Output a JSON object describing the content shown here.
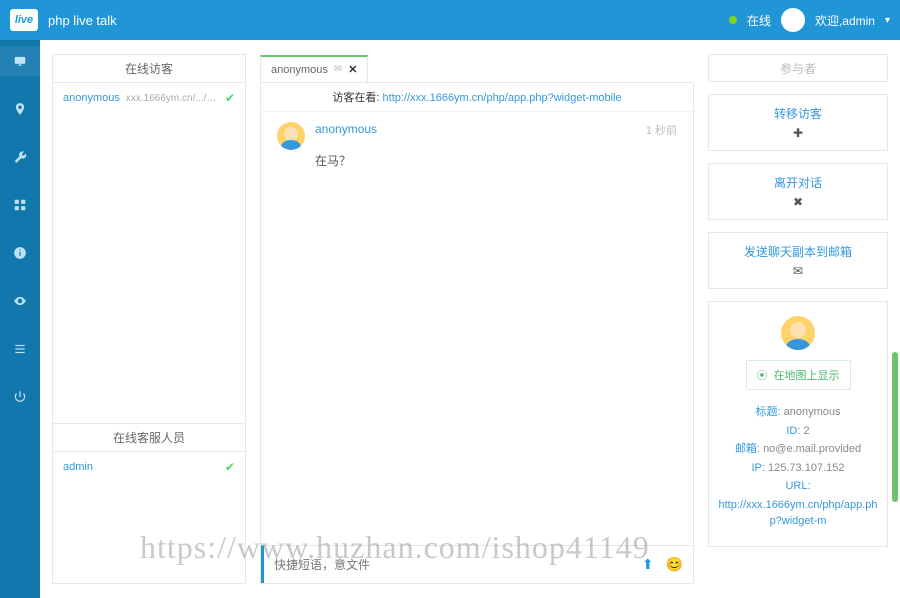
{
  "topbar": {
    "logo_text": "live",
    "title": "php live talk",
    "status": "在线",
    "welcome_prefix": "欢迎,",
    "user": "admin"
  },
  "left_panel": {
    "visitors_header": "在线访客",
    "visitor": {
      "name": "anonymous",
      "url": "xxx.1666ym.cn/.../app...",
      "status": "ok"
    },
    "agents_header": "在线客服人员",
    "agent": {
      "name": "admin",
      "status": "ok"
    }
  },
  "chat_tab": {
    "label": "anonymous"
  },
  "chat_header": {
    "label": "访客在看:",
    "link": "http://xxx.1666ym.cn/php/app.php?widget-mobile"
  },
  "message": {
    "name": "anonymous",
    "time": "1 秒前",
    "text": "在马？"
  },
  "input": {
    "placeholder": "快捷短语，意文件"
  },
  "right": {
    "participants": "参与者",
    "transfer": "转移访客",
    "leave": "离开对话",
    "send_transcript": "发送聊天副本到邮箱",
    "map_btn": "在地图上显示",
    "info": {
      "title_k": "标题:",
      "title_v": "anonymous",
      "id_k": "ID:",
      "id_v": "2",
      "email_k": "邮箱:",
      "email_v": "no@e.mail.provided",
      "ip_k": "IP:",
      "ip_v": "125.73.107.152",
      "url_k": "URL:",
      "url_v": "http://xxx.1666ym.cn/php/app.php?widget-m"
    }
  },
  "watermark": "https://www.huzhan.com/ishop41149"
}
